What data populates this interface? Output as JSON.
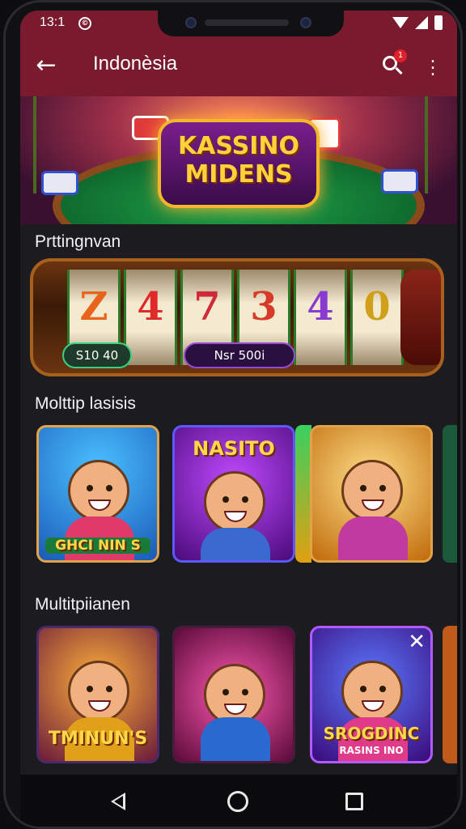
{
  "status_bar": {
    "time": "13:1",
    "notif_glyph": "©"
  },
  "app_bar": {
    "title": "Indonèsia",
    "badge_count": "1"
  },
  "hero": {
    "logo_line1": "KASSINO",
    "logo_line2": "MIDENS"
  },
  "sections": {
    "section1_title": "Prttingnvan",
    "section2_title": "Molttip lasisis",
    "section3_title": "Multitpiianen"
  },
  "slot": {
    "reels": [
      "Z",
      "4",
      "7",
      "3",
      "4",
      "0"
    ],
    "reel_colors": [
      "#e8641a",
      "#e02a2a",
      "#d02a3a",
      "#d83a2a",
      "#8a3ad0",
      "#d0a01a"
    ],
    "pill1": "S10 40",
    "pill2": "Nsr 500i"
  },
  "games_row1": [
    {
      "label": "GHCI NIN S",
      "bg": "#1a7ad8"
    },
    {
      "label": "NASITO",
      "bg": "#7a1aa8"
    },
    {
      "label": "",
      "bg": "#d07a10"
    }
  ],
  "games_row2": [
    {
      "label": "TMINUN'S",
      "bg": "#d04a1a"
    },
    {
      "label": "",
      "bg": "#8a1a5a"
    },
    {
      "label": "SROGDINC",
      "sublabel": "RASINS INO",
      "bg": "#5a2aa8"
    }
  ],
  "colors": {
    "app_bar": "#7a1a2e",
    "background": "#1b1b20",
    "accent": "#ffd84a"
  }
}
